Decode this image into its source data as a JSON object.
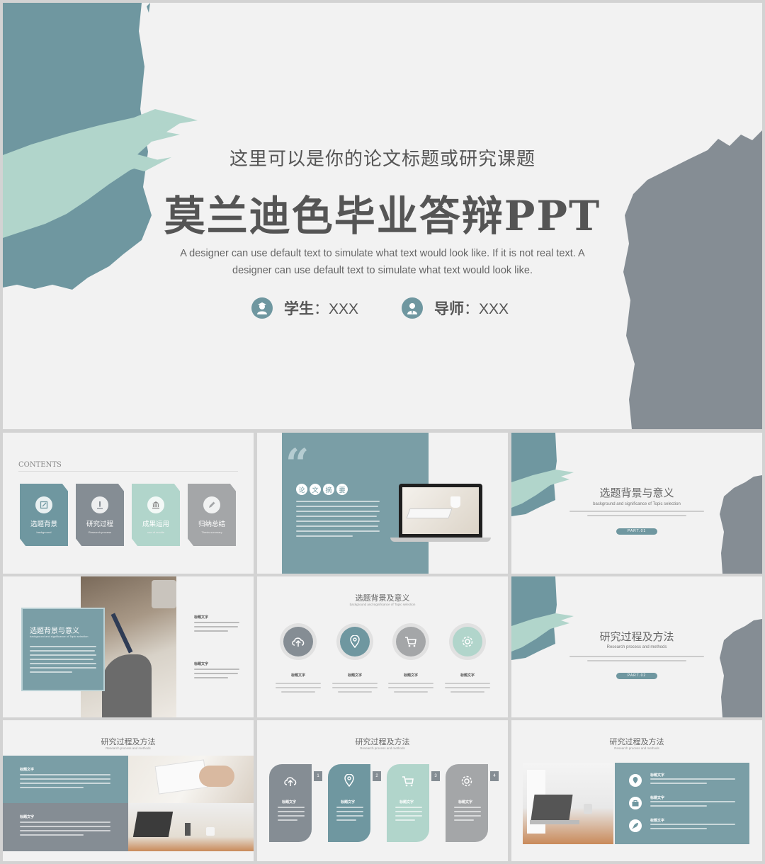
{
  "colors": {
    "teal": "#6f97a0",
    "mint": "#b1d5cb",
    "slate": "#858d94",
    "grey": "#a4a6a8",
    "bg": "#f2f2f2"
  },
  "cover": {
    "subtitle": "这里可以是你的论文标题或研究课题",
    "title": "莫兰迪色毕业答辩PPT",
    "desc_line1": "A designer can use default text to simulate what text would look like. If it is not real text. A",
    "desc_line2": "designer can use default text to simulate what text would look like.",
    "student_label": "学生",
    "student_value": "：XXX",
    "mentor_label": "导师",
    "mentor_value": "：XXX",
    "student_icon": "student-avatar-icon",
    "mentor_icon": "teacher-avatar-icon"
  },
  "thumbs": {
    "contents": {
      "heading": "CONTENTS",
      "items": [
        {
          "label": "选题背景",
          "en": "background",
          "icon": "edit-icon"
        },
        {
          "label": "研究过程",
          "en": "Research process",
          "icon": "microscope-icon"
        },
        {
          "label": "成果运用",
          "en": "use of results",
          "icon": "bank-icon"
        },
        {
          "label": "归纳总结",
          "en": "Thesis summary",
          "icon": "pen-icon"
        }
      ]
    },
    "abstract": {
      "chars": [
        "论",
        "文",
        "摘",
        "要"
      ]
    },
    "section1": {
      "title": "选题背景与意义",
      "en": "background and significance of Topic selection",
      "body": "A designer can use default text to simulate what text would look like. If it is not real text. A designer can use default text to simulate what text would look like.",
      "part": "PART.01"
    },
    "bg_slide": {
      "title": "选题背景与意义",
      "en": "background and significance of Topic selection",
      "label1": "标题文字",
      "label2": "标题文字"
    },
    "icons_slide": {
      "title": "选题背景及意义",
      "en": "background and significance of Topic selection",
      "items": [
        {
          "label": "标题文字",
          "icon": "cloud-upload-icon"
        },
        {
          "label": "标题文字",
          "icon": "location-pin-icon"
        },
        {
          "label": "标题文字",
          "icon": "shopping-cart-icon"
        },
        {
          "label": "标题文字",
          "icon": "gear-icon"
        }
      ]
    },
    "section2": {
      "title": "研究过程及方法",
      "en": "Research process and methods",
      "body": "A designer can use default text to simulate what text would look like. If it is not real text. A designer can use default text to simulate what text would look like.",
      "part": "PART.02"
    },
    "research1": {
      "title": "研究过程及方法",
      "en": "Research process and methods",
      "label1": "标题文字",
      "label2": "标题文字"
    },
    "research2": {
      "title": "研究过程及方法",
      "en": "Research process and methods",
      "items": [
        {
          "num": "1",
          "label": "标题文字",
          "icon": "cloud-upload-icon"
        },
        {
          "num": "2",
          "label": "标题文字",
          "icon": "location-pin-icon"
        },
        {
          "num": "3",
          "label": "标题文字",
          "icon": "shopping-cart-icon"
        },
        {
          "num": "4",
          "label": "标题文字",
          "icon": "gear-icon"
        }
      ]
    },
    "research3": {
      "title": "研究过程及方法",
      "en": "Research process and methods",
      "items": [
        {
          "label": "标题文字",
          "icon": "location-pin-icon"
        },
        {
          "label": "标题文字",
          "icon": "briefcase-icon"
        },
        {
          "label": "标题文字",
          "icon": "rocket-icon"
        }
      ]
    }
  }
}
